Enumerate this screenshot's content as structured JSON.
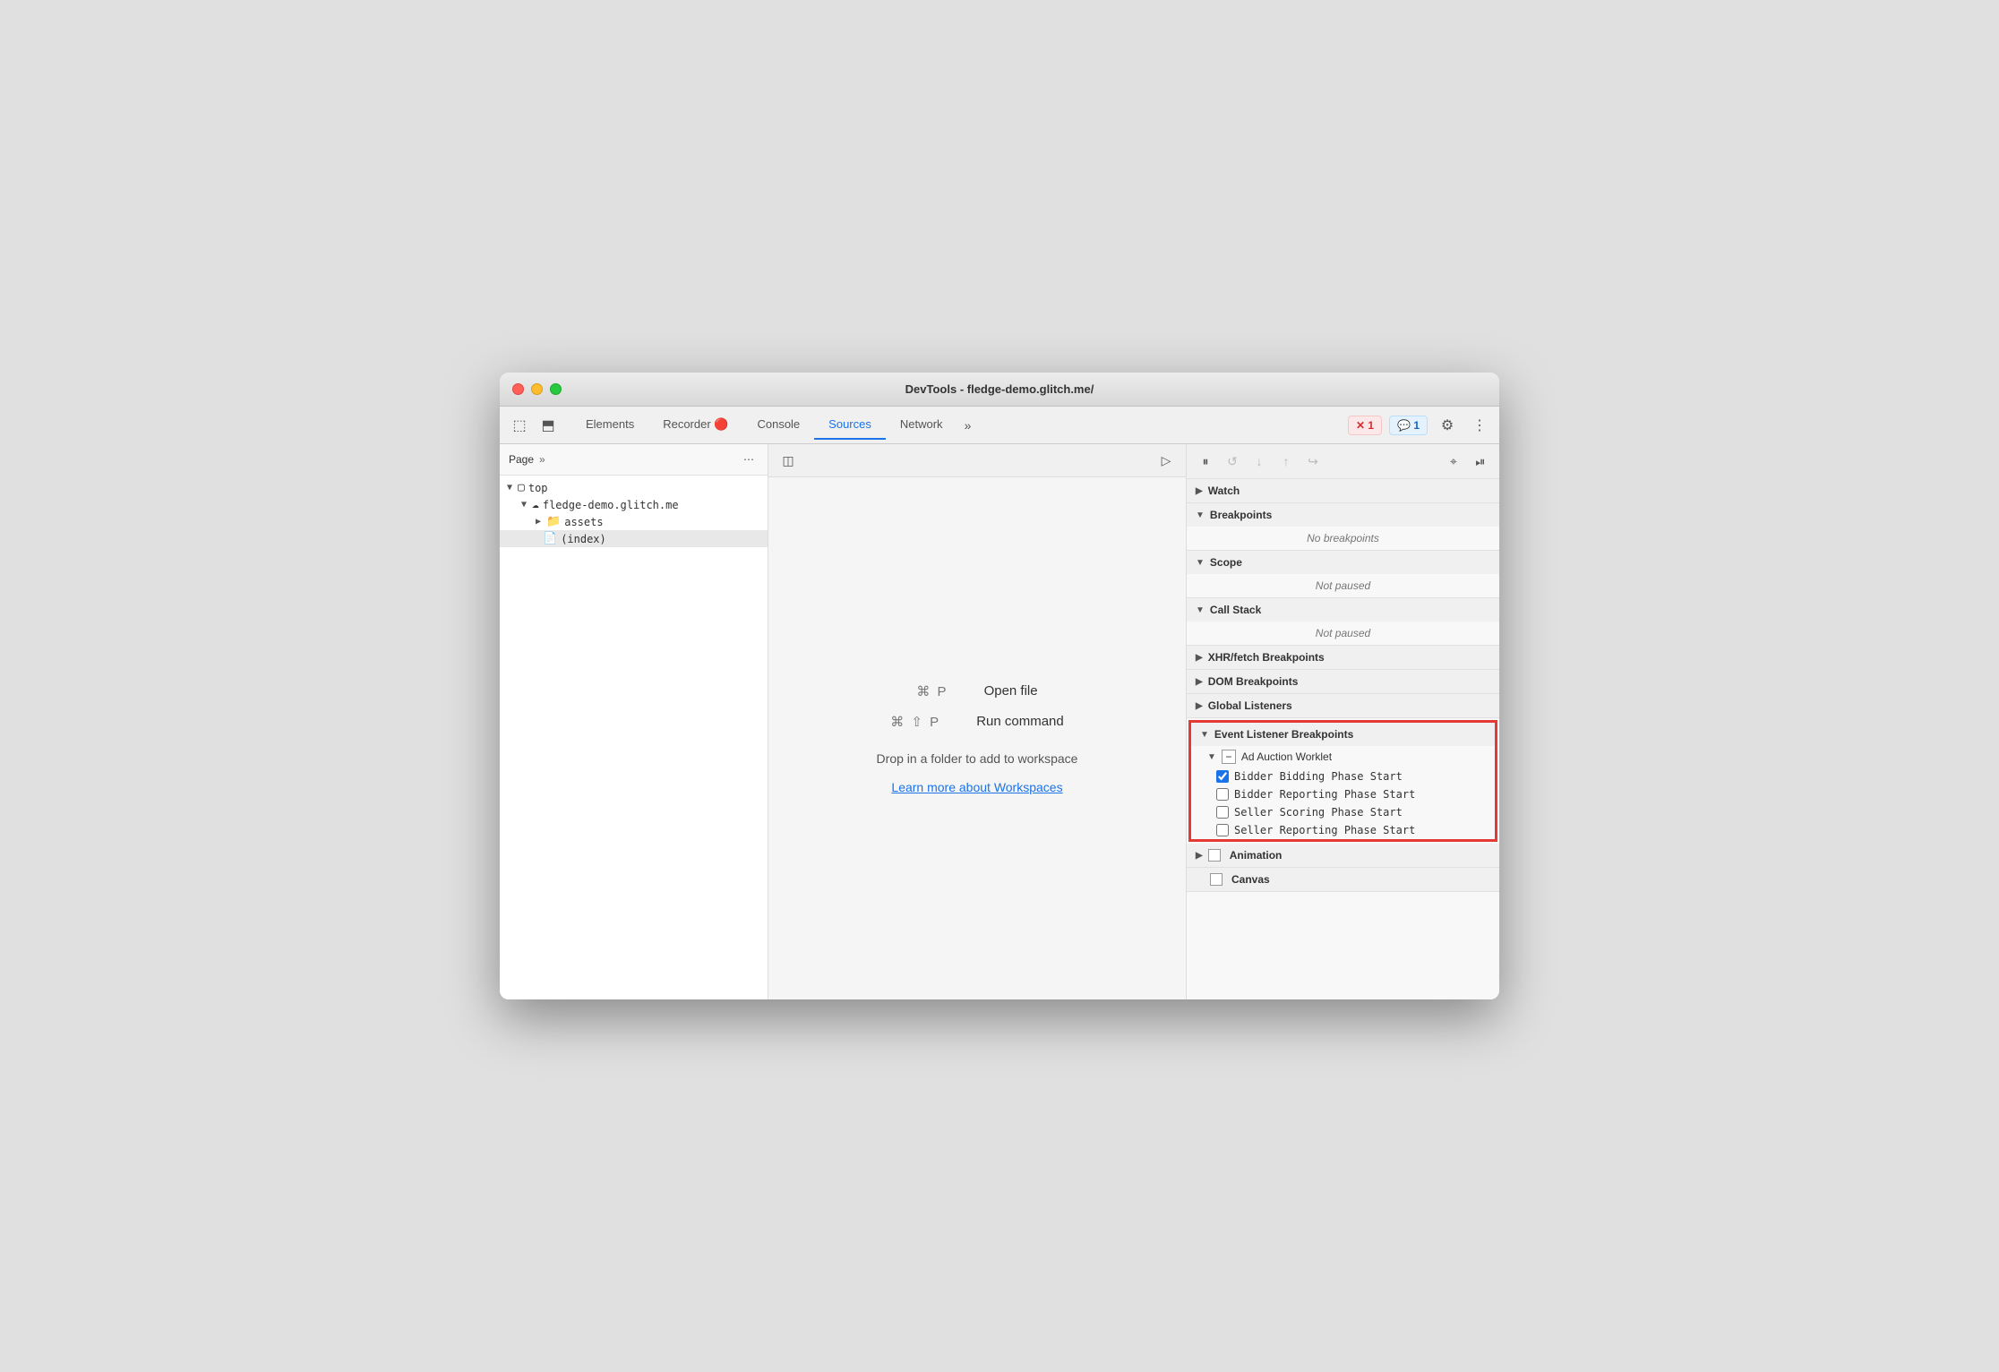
{
  "window": {
    "title": "DevTools - fledge-demo.glitch.me/"
  },
  "tabs": [
    {
      "id": "elements",
      "label": "Elements",
      "active": false
    },
    {
      "id": "recorder",
      "label": "Recorder 🔴",
      "active": false
    },
    {
      "id": "console",
      "label": "Console",
      "active": false
    },
    {
      "id": "sources",
      "label": "Sources",
      "active": true
    },
    {
      "id": "network",
      "label": "Network",
      "active": false
    }
  ],
  "badges": {
    "error": {
      "count": "1",
      "label": "✕ 1"
    },
    "info": {
      "count": "1",
      "label": "💬 1"
    }
  },
  "file_panel": {
    "tab_label": "Page",
    "tree": [
      {
        "level": 0,
        "arrow": "▼",
        "icon": "📄",
        "label": "top",
        "icon_type": "folder"
      },
      {
        "level": 1,
        "arrow": "▼",
        "icon": "☁",
        "label": "fledge-demo.glitch.me",
        "icon_type": "cloud"
      },
      {
        "level": 2,
        "arrow": "▶",
        "icon": "📁",
        "label": "assets",
        "icon_type": "folder",
        "selected": false
      },
      {
        "level": 2,
        "arrow": "",
        "icon": "📄",
        "label": "(index)",
        "icon_type": "file",
        "selected": true
      }
    ]
  },
  "editor": {
    "shortcut1": {
      "keys": "⌘ P",
      "label": "Open file"
    },
    "shortcut2": {
      "keys": "⌘ ⇧ P",
      "label": "Run command"
    },
    "workspace_text": "Drop in a folder to add to workspace",
    "workspace_link": "Learn more about Workspaces"
  },
  "debugger": {
    "sections": [
      {
        "id": "watch",
        "label": "Watch",
        "collapsed": true
      },
      {
        "id": "breakpoints",
        "label": "Breakpoints",
        "collapsed": false,
        "content": "No breakpoints"
      },
      {
        "id": "scope",
        "label": "Scope",
        "collapsed": false,
        "content": "Not paused"
      },
      {
        "id": "call-stack",
        "label": "Call Stack",
        "collapsed": false,
        "content": "Not paused"
      },
      {
        "id": "xhr-breakpoints",
        "label": "XHR/fetch Breakpoints",
        "collapsed": true
      },
      {
        "id": "dom-breakpoints",
        "label": "DOM Breakpoints",
        "collapsed": true
      },
      {
        "id": "global-listeners",
        "label": "Global Listeners",
        "collapsed": true
      }
    ],
    "event_listener_breakpoints": {
      "label": "Event Listener Breakpoints",
      "ad_auction": {
        "label": "Ad Auction Worklet",
        "items": [
          {
            "id": "bidder-bidding",
            "label": "Bidder Bidding Phase Start",
            "checked": true
          },
          {
            "id": "bidder-reporting",
            "label": "Bidder Reporting Phase Start",
            "checked": false
          },
          {
            "id": "seller-scoring",
            "label": "Seller Scoring Phase Start",
            "checked": false
          },
          {
            "id": "seller-reporting",
            "label": "Seller Reporting Phase Start",
            "checked": false
          }
        ]
      }
    },
    "animation_section": {
      "label": "Animation",
      "collapsed": true
    },
    "canvas_section": {
      "label": "Canvas",
      "collapsed": true
    }
  }
}
